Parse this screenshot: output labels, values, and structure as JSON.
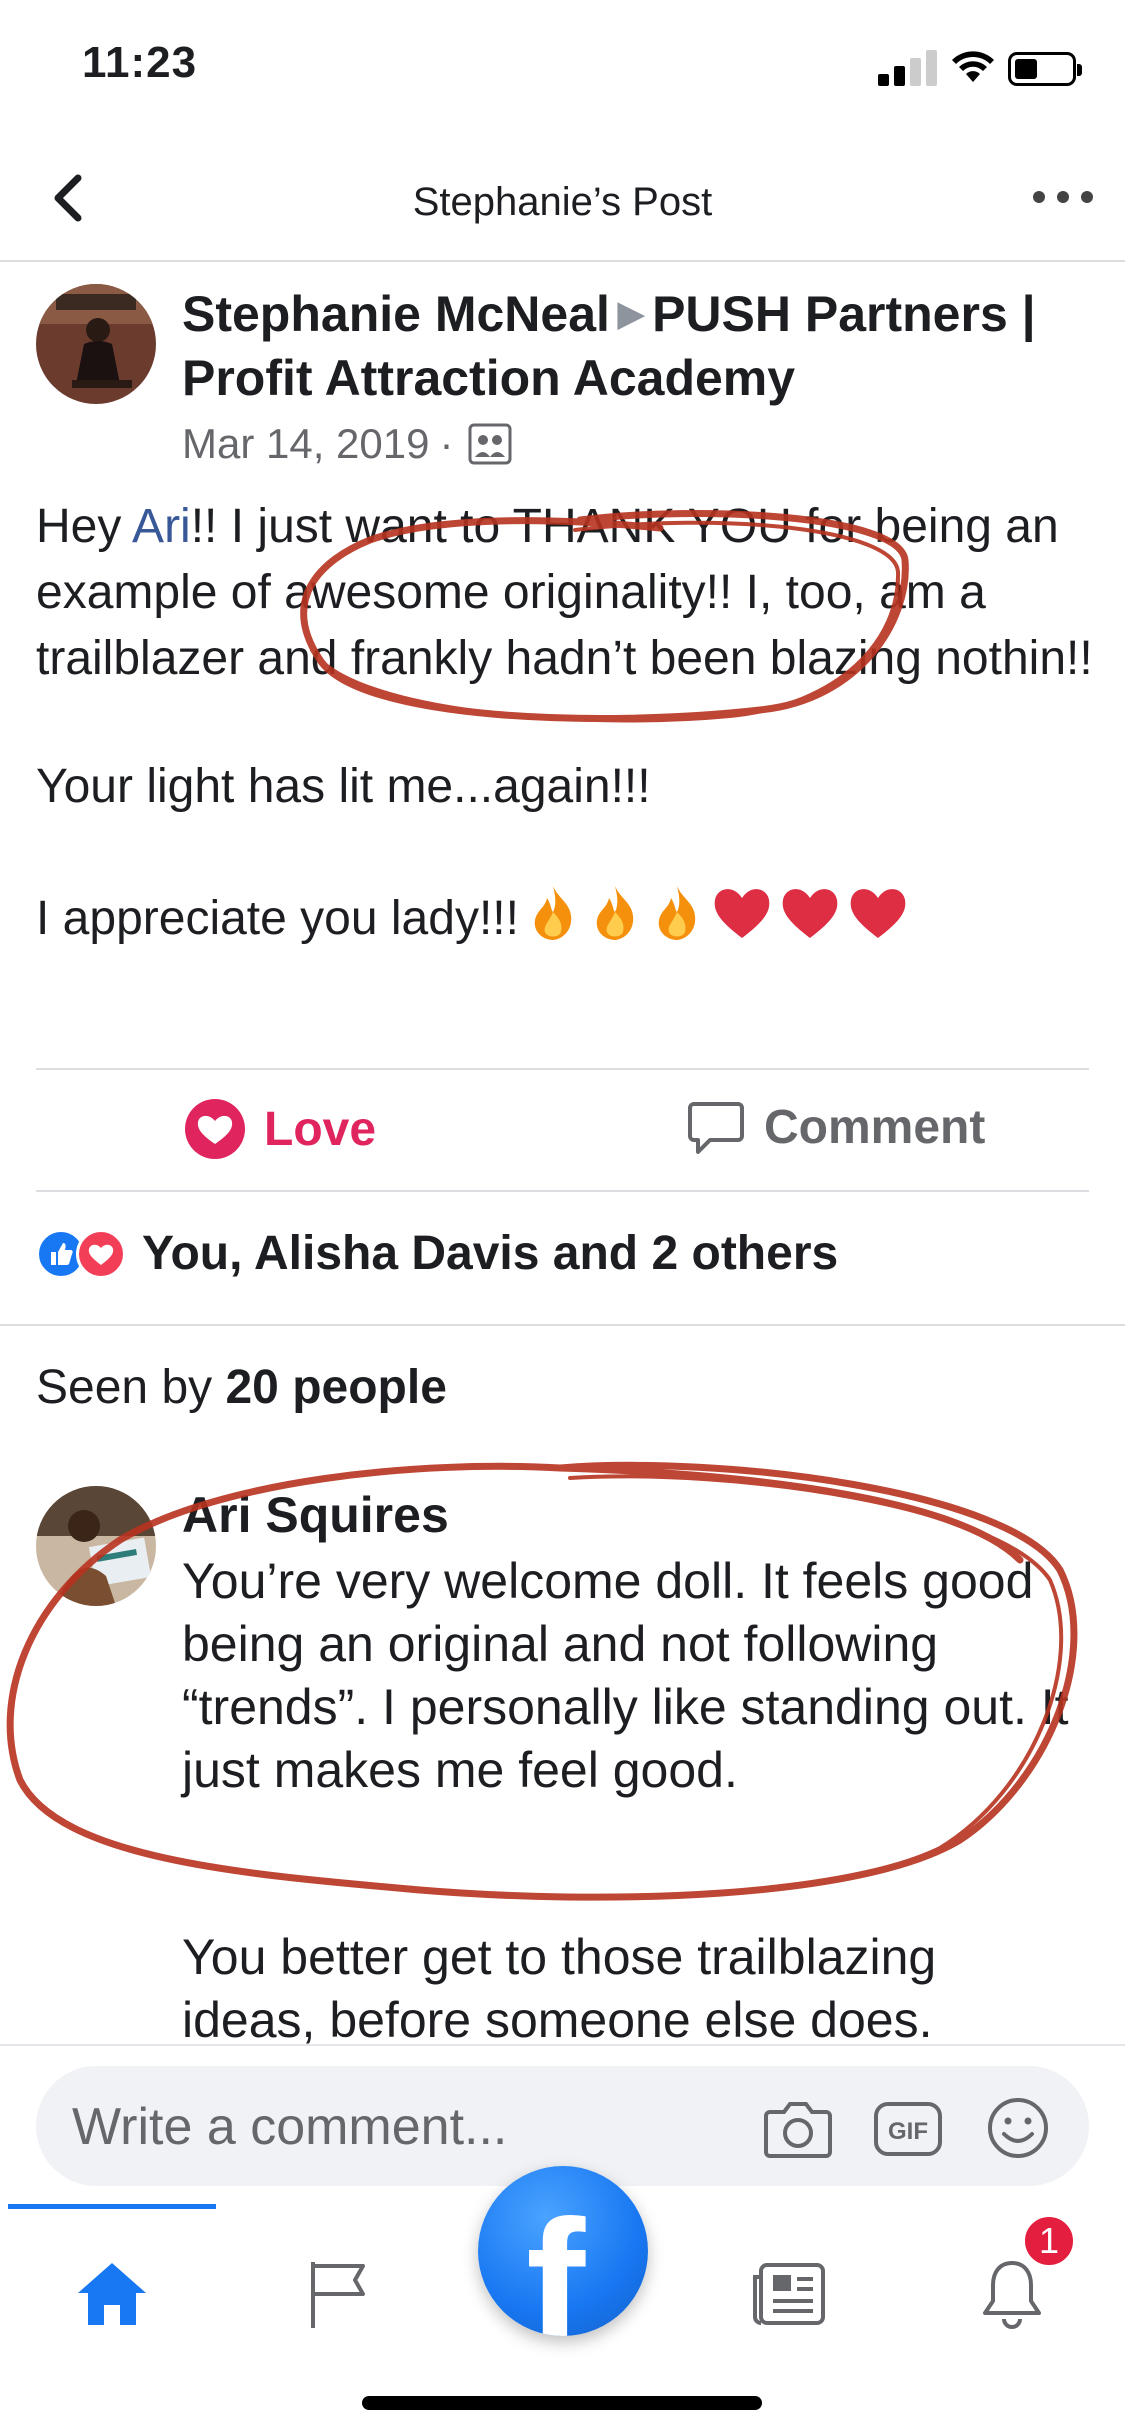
{
  "status_bar": {
    "time": "11:23"
  },
  "header": {
    "title": "Stephanie’s Post"
  },
  "post": {
    "author": "Stephanie McNeal",
    "target": "PUSH Partners | Profit Attraction Academy",
    "date": "Mar 14, 2019",
    "dot": "·",
    "line1_pre": "Hey ",
    "mention": "Ari",
    "line1_post": "!!  I just want to THANK YOU for being an example of awesome originality!!  I, too, am a trailblazer and frankly hadn’t been blazing nothin!!",
    "para2": "Your light has lit me...again!!!",
    "para3": "I appreciate you lady!!!",
    "emojis": [
      "fire",
      "fire",
      "fire",
      "heart",
      "heart",
      "heart"
    ]
  },
  "actions": {
    "love_label": "Love",
    "comment_label": "Comment"
  },
  "reactions": {
    "text": "You, Alisha Davis and 2 others"
  },
  "seen": {
    "prefix": "Seen by ",
    "count": "20 people"
  },
  "comment": {
    "author": "Ari Squires",
    "text": "You’re very welcome doll. It feels good being an original and not following “trends”. I personally like standing out. It just makes me feel good.",
    "text2": "You better get to those trailblazing ideas, before someone else does."
  },
  "composer": {
    "placeholder": "Write a comment..."
  },
  "tabbar": {
    "notification_count": "1"
  },
  "colors": {
    "accent": "#1877f2",
    "love": "#e0245e",
    "annotation": "#b8321f"
  }
}
